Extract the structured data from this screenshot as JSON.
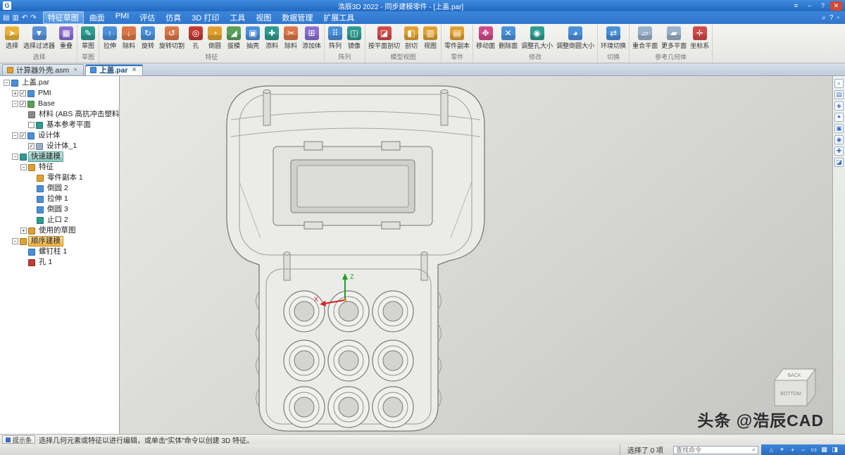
{
  "titlebar": {
    "title": "浩辰3D 2022 - 同步建模零件 - [上盖.par]",
    "logo_letter": "G",
    "controls": [
      {
        "glyph": "≡"
      },
      {
        "glyph": "–"
      },
      {
        "glyph": "?"
      },
      {
        "glyph": "✕"
      }
    ]
  },
  "menubar": {
    "quick_icons": [
      {
        "glyph": "▤"
      },
      {
        "glyph": "▥"
      },
      {
        "glyph": "↶"
      },
      {
        "glyph": "↷"
      }
    ],
    "items": [
      {
        "label": "特征草图",
        "active": true
      },
      {
        "label": "曲面"
      },
      {
        "label": "PMI"
      },
      {
        "label": "评估"
      },
      {
        "label": "仿真"
      },
      {
        "label": "3D 打印"
      },
      {
        "label": "工具"
      },
      {
        "label": "视图"
      },
      {
        "label": "数据管理"
      },
      {
        "label": "扩展工具"
      }
    ],
    "right_icons": [
      {
        "glyph": "⌕"
      },
      {
        "glyph": "?"
      },
      {
        "glyph": "▫"
      }
    ]
  },
  "ribbon": {
    "groups": [
      {
        "name": "选择",
        "buttons": [
          {
            "label": "选择",
            "glyph": "➤",
            "color": "#e8b239"
          },
          {
            "label": "选择过滤器",
            "glyph": "▼",
            "color": "#5b8fd6"
          },
          {
            "label": "重叠",
            "glyph": "▦",
            "color": "#8a6fd0"
          }
        ]
      },
      {
        "name": "草图",
        "buttons": [
          {
            "label": "草图",
            "glyph": "✎",
            "color": "#2e9b8f"
          }
        ]
      },
      {
        "name": "特征",
        "buttons": [
          {
            "label": "拉伸",
            "glyph": "↑",
            "color": "#4a90d9"
          },
          {
            "label": "除料",
            "glyph": "↓",
            "color": "#d9774a"
          },
          {
            "label": "旋转",
            "glyph": "↻",
            "color": "#4a90d9"
          },
          {
            "label": "旋转切割",
            "glyph": "↺",
            "color": "#d9774a"
          },
          {
            "label": "孔",
            "glyph": "◎",
            "color": "#c23b34"
          },
          {
            "label": "倒圆",
            "glyph": "◔",
            "color": "#e0a030"
          },
          {
            "label": "拔模",
            "glyph": "◢",
            "color": "#5aa05a"
          },
          {
            "label": "抽壳",
            "glyph": "▣",
            "color": "#4a90d9"
          },
          {
            "label": "添料",
            "glyph": "✚",
            "color": "#2e9b8f"
          },
          {
            "label": "除料",
            "glyph": "✂",
            "color": "#d9774a"
          },
          {
            "label": "添加体",
            "glyph": "⊞",
            "color": "#8a6fd0"
          }
        ]
      },
      {
        "name": "阵列",
        "buttons": [
          {
            "label": "阵列",
            "glyph": "⠿",
            "color": "#4a90d9"
          },
          {
            "label": "镜像",
            "glyph": "◫",
            "color": "#2e9b8f"
          }
        ]
      },
      {
        "name": "模型视图",
        "buttons": [
          {
            "label": "按平面剖切",
            "glyph": "◪",
            "color": "#d04a4a"
          },
          {
            "label": "剖切",
            "glyph": "◧",
            "color": "#e0a030"
          },
          {
            "label": "视图",
            "glyph": "▥",
            "color": "#e0a030"
          }
        ]
      },
      {
        "name": "零件",
        "buttons": [
          {
            "label": "零件副本",
            "glyph": "▤",
            "color": "#e0a030"
          }
        ]
      },
      {
        "name": "修改",
        "buttons": [
          {
            "label": "移动面",
            "glyph": "✥",
            "color": "#d04a8a"
          },
          {
            "label": "删除面",
            "glyph": "✕",
            "color": "#4a90d9"
          },
          {
            "label": "调整孔大小",
            "glyph": "◉",
            "color": "#2e9b8f"
          },
          {
            "label": "调整倒圆大小",
            "glyph": "◕",
            "color": "#4a90d9"
          }
        ]
      },
      {
        "name": "切换",
        "buttons": [
          {
            "label": "环境切换",
            "glyph": "⇄",
            "color": "#4a90d9"
          }
        ]
      },
      {
        "name": "参考几何体",
        "buttons": [
          {
            "label": "重合平面",
            "glyph": "▱",
            "color": "#9ab0c8"
          },
          {
            "label": "更多平面",
            "glyph": "▰",
            "color": "#9ab0c8"
          },
          {
            "label": "坐标系",
            "glyph": "✛",
            "color": "#d04a4a"
          }
        ]
      }
    ]
  },
  "doc_tabs": {
    "close_glyph": "×",
    "tabs": [
      {
        "label": "计算器外壳.asm",
        "icon_color": "#e0a030",
        "active": false
      },
      {
        "label": "上盖.par",
        "icon_color": "#4a90d9",
        "active": true
      }
    ]
  },
  "tree": {
    "items": [
      {
        "label": "上盖.par",
        "pad": "0px",
        "exp": "−",
        "ic": "#4a90d9"
      },
      {
        "label": "PMI",
        "pad": "12px",
        "exp": "+",
        "ic": "#4a90d9",
        "checkbox": "checked"
      },
      {
        "label": "Base",
        "pad": "12px",
        "exp": "−",
        "ic": "#5aa05a",
        "checkbox": "checked"
      },
      {
        "label": "材料 (ABS 高抗冲击塑料)",
        "pad": "24px",
        "exp": "",
        "ic": "#8a8a88"
      },
      {
        "label": "基本参考平面",
        "pad": "24px",
        "exp": "",
        "ic": "#2e9b8f",
        "checkbox": "unchecked"
      },
      {
        "label": "设计体",
        "pad": "12px",
        "exp": "−",
        "ic": "#4a90d9",
        "checkbox": "checked"
      },
      {
        "label": "设计体_1",
        "pad": "24px",
        "exp": "",
        "ic": "#9ab0c8",
        "checkbox": "checked"
      },
      {
        "label": "快速建模",
        "pad": "12px",
        "exp": "−",
        "ic": "#2e9b8f",
        "highlight": "teal"
      },
      {
        "label": "特征",
        "pad": "24px",
        "exp": "−",
        "ic": "#e0a030"
      },
      {
        "label": "零件副本 1",
        "pad": "36px",
        "exp": "",
        "ic": "#e0a030"
      },
      {
        "label": "倒圆 2",
        "pad": "36px",
        "exp": "",
        "ic": "#4a90d9"
      },
      {
        "label": "拉伸 1",
        "pad": "36px",
        "exp": "",
        "ic": "#4a90d9"
      },
      {
        "label": "倒圆 3",
        "pad": "36px",
        "exp": "",
        "ic": "#4a90d9"
      },
      {
        "label": "止口 2",
        "pad": "36px",
        "exp": "",
        "ic": "#2e9b8f"
      },
      {
        "label": "使用的草图",
        "pad": "24px",
        "exp": "+",
        "ic": "#e0a030"
      },
      {
        "label": "顺序建模",
        "pad": "12px",
        "exp": "−",
        "ic": "#e0a030",
        "highlight": "orange"
      },
      {
        "label": "螺钉柱 1",
        "pad": "24px",
        "exp": "",
        "ic": "#4a90d9"
      },
      {
        "label": "孔 1",
        "pad": "24px",
        "exp": "",
        "ic": "#c23b34"
      }
    ]
  },
  "viewport": {
    "watermark": "头条 @浩辰CAD",
    "viewcube": {
      "top": "BACK",
      "front": "BOTTOM"
    },
    "triad": {
      "x": "X",
      "z": "Z"
    }
  },
  "right_toolbar": {
    "icons": [
      {
        "glyph": "⌕"
      },
      {
        "glyph": "▤"
      },
      {
        "glyph": "◈"
      },
      {
        "glyph": "✦"
      },
      {
        "glyph": "▣"
      },
      {
        "glyph": "◉"
      },
      {
        "glyph": "✚"
      },
      {
        "glyph": "◪"
      }
    ]
  },
  "statusbar": {
    "hint_label": "提示条",
    "hint_text": "选择几何元素或特征以进行编辑，或单击“实体”命令以创建 3D 特征。",
    "selection": "选择了 0 项",
    "search_placeholder": "查找命令",
    "search_icon": "⌕",
    "view_icons": [
      {
        "glyph": "⌂"
      },
      {
        "glyph": "⌖"
      },
      {
        "glyph": "+"
      },
      {
        "glyph": "−"
      },
      {
        "glyph": "▭"
      },
      {
        "glyph": "▦"
      },
      {
        "glyph": "◨"
      }
    ]
  }
}
